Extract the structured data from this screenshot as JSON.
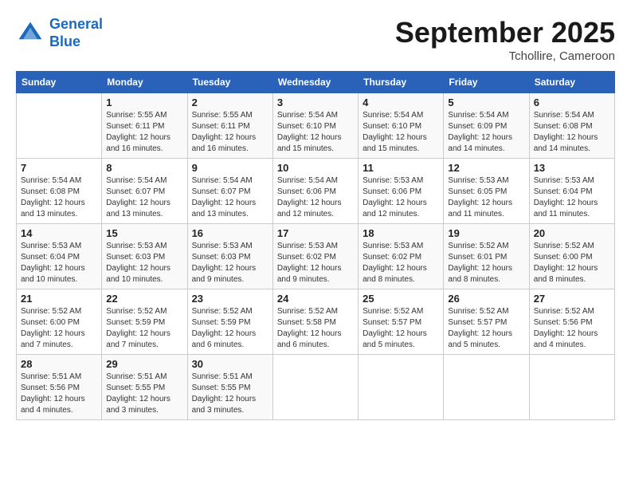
{
  "header": {
    "logo_line1": "General",
    "logo_line2": "Blue",
    "month_title": "September 2025",
    "location": "Tchollire, Cameroon"
  },
  "weekdays": [
    "Sunday",
    "Monday",
    "Tuesday",
    "Wednesday",
    "Thursday",
    "Friday",
    "Saturday"
  ],
  "weeks": [
    [
      {
        "day": "",
        "sunrise": "",
        "sunset": "",
        "daylight": ""
      },
      {
        "day": "1",
        "sunrise": "Sunrise: 5:55 AM",
        "sunset": "Sunset: 6:11 PM",
        "daylight": "Daylight: 12 hours and 16 minutes."
      },
      {
        "day": "2",
        "sunrise": "Sunrise: 5:55 AM",
        "sunset": "Sunset: 6:11 PM",
        "daylight": "Daylight: 12 hours and 16 minutes."
      },
      {
        "day": "3",
        "sunrise": "Sunrise: 5:54 AM",
        "sunset": "Sunset: 6:10 PM",
        "daylight": "Daylight: 12 hours and 15 minutes."
      },
      {
        "day": "4",
        "sunrise": "Sunrise: 5:54 AM",
        "sunset": "Sunset: 6:10 PM",
        "daylight": "Daylight: 12 hours and 15 minutes."
      },
      {
        "day": "5",
        "sunrise": "Sunrise: 5:54 AM",
        "sunset": "Sunset: 6:09 PM",
        "daylight": "Daylight: 12 hours and 14 minutes."
      },
      {
        "day": "6",
        "sunrise": "Sunrise: 5:54 AM",
        "sunset": "Sunset: 6:08 PM",
        "daylight": "Daylight: 12 hours and 14 minutes."
      }
    ],
    [
      {
        "day": "7",
        "sunrise": "Sunrise: 5:54 AM",
        "sunset": "Sunset: 6:08 PM",
        "daylight": "Daylight: 12 hours and 13 minutes."
      },
      {
        "day": "8",
        "sunrise": "Sunrise: 5:54 AM",
        "sunset": "Sunset: 6:07 PM",
        "daylight": "Daylight: 12 hours and 13 minutes."
      },
      {
        "day": "9",
        "sunrise": "Sunrise: 5:54 AM",
        "sunset": "Sunset: 6:07 PM",
        "daylight": "Daylight: 12 hours and 13 minutes."
      },
      {
        "day": "10",
        "sunrise": "Sunrise: 5:54 AM",
        "sunset": "Sunset: 6:06 PM",
        "daylight": "Daylight: 12 hours and 12 minutes."
      },
      {
        "day": "11",
        "sunrise": "Sunrise: 5:53 AM",
        "sunset": "Sunset: 6:06 PM",
        "daylight": "Daylight: 12 hours and 12 minutes."
      },
      {
        "day": "12",
        "sunrise": "Sunrise: 5:53 AM",
        "sunset": "Sunset: 6:05 PM",
        "daylight": "Daylight: 12 hours and 11 minutes."
      },
      {
        "day": "13",
        "sunrise": "Sunrise: 5:53 AM",
        "sunset": "Sunset: 6:04 PM",
        "daylight": "Daylight: 12 hours and 11 minutes."
      }
    ],
    [
      {
        "day": "14",
        "sunrise": "Sunrise: 5:53 AM",
        "sunset": "Sunset: 6:04 PM",
        "daylight": "Daylight: 12 hours and 10 minutes."
      },
      {
        "day": "15",
        "sunrise": "Sunrise: 5:53 AM",
        "sunset": "Sunset: 6:03 PM",
        "daylight": "Daylight: 12 hours and 10 minutes."
      },
      {
        "day": "16",
        "sunrise": "Sunrise: 5:53 AM",
        "sunset": "Sunset: 6:03 PM",
        "daylight": "Daylight: 12 hours and 9 minutes."
      },
      {
        "day": "17",
        "sunrise": "Sunrise: 5:53 AM",
        "sunset": "Sunset: 6:02 PM",
        "daylight": "Daylight: 12 hours and 9 minutes."
      },
      {
        "day": "18",
        "sunrise": "Sunrise: 5:53 AM",
        "sunset": "Sunset: 6:02 PM",
        "daylight": "Daylight: 12 hours and 8 minutes."
      },
      {
        "day": "19",
        "sunrise": "Sunrise: 5:52 AM",
        "sunset": "Sunset: 6:01 PM",
        "daylight": "Daylight: 12 hours and 8 minutes."
      },
      {
        "day": "20",
        "sunrise": "Sunrise: 5:52 AM",
        "sunset": "Sunset: 6:00 PM",
        "daylight": "Daylight: 12 hours and 8 minutes."
      }
    ],
    [
      {
        "day": "21",
        "sunrise": "Sunrise: 5:52 AM",
        "sunset": "Sunset: 6:00 PM",
        "daylight": "Daylight: 12 hours and 7 minutes."
      },
      {
        "day": "22",
        "sunrise": "Sunrise: 5:52 AM",
        "sunset": "Sunset: 5:59 PM",
        "daylight": "Daylight: 12 hours and 7 minutes."
      },
      {
        "day": "23",
        "sunrise": "Sunrise: 5:52 AM",
        "sunset": "Sunset: 5:59 PM",
        "daylight": "Daylight: 12 hours and 6 minutes."
      },
      {
        "day": "24",
        "sunrise": "Sunrise: 5:52 AM",
        "sunset": "Sunset: 5:58 PM",
        "daylight": "Daylight: 12 hours and 6 minutes."
      },
      {
        "day": "25",
        "sunrise": "Sunrise: 5:52 AM",
        "sunset": "Sunset: 5:57 PM",
        "daylight": "Daylight: 12 hours and 5 minutes."
      },
      {
        "day": "26",
        "sunrise": "Sunrise: 5:52 AM",
        "sunset": "Sunset: 5:57 PM",
        "daylight": "Daylight: 12 hours and 5 minutes."
      },
      {
        "day": "27",
        "sunrise": "Sunrise: 5:52 AM",
        "sunset": "Sunset: 5:56 PM",
        "daylight": "Daylight: 12 hours and 4 minutes."
      }
    ],
    [
      {
        "day": "28",
        "sunrise": "Sunrise: 5:51 AM",
        "sunset": "Sunset: 5:56 PM",
        "daylight": "Daylight: 12 hours and 4 minutes."
      },
      {
        "day": "29",
        "sunrise": "Sunrise: 5:51 AM",
        "sunset": "Sunset: 5:55 PM",
        "daylight": "Daylight: 12 hours and 3 minutes."
      },
      {
        "day": "30",
        "sunrise": "Sunrise: 5:51 AM",
        "sunset": "Sunset: 5:55 PM",
        "daylight": "Daylight: 12 hours and 3 minutes."
      },
      {
        "day": "",
        "sunrise": "",
        "sunset": "",
        "daylight": ""
      },
      {
        "day": "",
        "sunrise": "",
        "sunset": "",
        "daylight": ""
      },
      {
        "day": "",
        "sunrise": "",
        "sunset": "",
        "daylight": ""
      },
      {
        "day": "",
        "sunrise": "",
        "sunset": "",
        "daylight": ""
      }
    ]
  ]
}
